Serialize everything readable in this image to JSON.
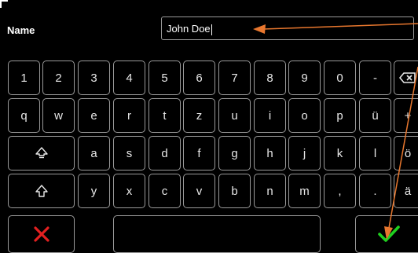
{
  "form": {
    "label": "Name",
    "input_value": "John Doe"
  },
  "keyboard": {
    "row1": [
      "1",
      "2",
      "3",
      "4",
      "5",
      "6",
      "7",
      "8",
      "9",
      "0",
      "-"
    ],
    "row2": [
      "q",
      "w",
      "e",
      "r",
      "t",
      "z",
      "u",
      "i",
      "o",
      "p",
      "ü",
      "+"
    ],
    "row3": [
      "a",
      "s",
      "d",
      "f",
      "g",
      "h",
      "j",
      "k",
      "l",
      "ö"
    ],
    "row4": [
      "y",
      "x",
      "c",
      "v",
      "b",
      "n",
      "m",
      ",",
      ".",
      "ä"
    ]
  },
  "icons": {
    "backspace": "backspace-icon",
    "caps": "caps-lock-icon",
    "shift": "shift-icon",
    "cancel": "cancel-x-icon",
    "confirm": "confirm-check-icon"
  },
  "colors": {
    "background": "#000000",
    "key_border": "#9a9a9a",
    "cancel": "#e32020",
    "confirm": "#1fd11f",
    "annotation_arrow": "#e8772e"
  }
}
